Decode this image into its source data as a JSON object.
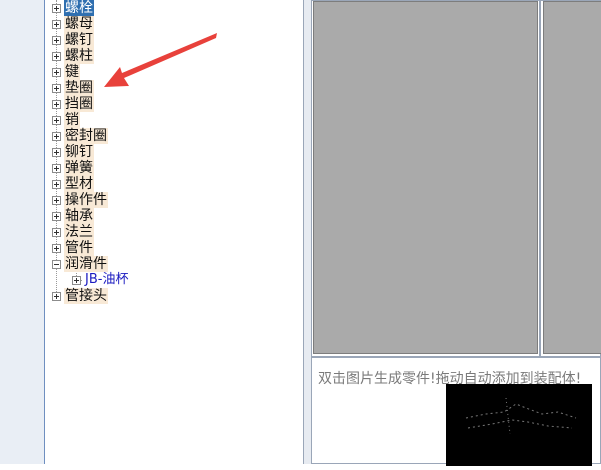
{
  "tree": {
    "items": [
      {
        "label": "螺栓",
        "selected": true
      },
      {
        "label": "螺母"
      },
      {
        "label": "螺钉"
      },
      {
        "label": "螺柱"
      },
      {
        "label": "键"
      },
      {
        "label": "垫圈"
      },
      {
        "label": "挡圈"
      },
      {
        "label": "销"
      },
      {
        "label": "密封圈"
      },
      {
        "label": "铆钉"
      },
      {
        "label": "弹簧"
      },
      {
        "label": "型材"
      },
      {
        "label": "操作件"
      },
      {
        "label": "轴承"
      },
      {
        "label": "法兰"
      },
      {
        "label": "管件"
      },
      {
        "label": "润滑件",
        "expanded": true
      },
      {
        "label": "JB-油杯",
        "child": true
      },
      {
        "label": "管接头"
      }
    ]
  },
  "annotation": {
    "arrow_color": "#e8413b",
    "icon": "red-arrow-icon"
  },
  "bottom_panel": {
    "hint": "双击图片生成零件!拖动自动添加到装配体!"
  },
  "colors": {
    "preview": "#aaaaaa",
    "label_bg": "#f8e9d6",
    "selected_bg": "#2f6fb0"
  }
}
